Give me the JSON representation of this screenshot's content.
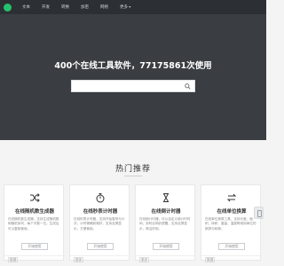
{
  "nav": {
    "items": [
      {
        "label": "文本"
      },
      {
        "label": "开发"
      },
      {
        "label": "转换"
      },
      {
        "label": "加密"
      },
      {
        "label": "网络"
      },
      {
        "label": "更多"
      }
    ]
  },
  "hero": {
    "title": "400个在线工具软件，77175861次使用",
    "search": {
      "placeholder": "",
      "value": ""
    }
  },
  "section": {
    "title": "热门推荐"
  },
  "cards": [
    {
      "icon": "shuffle-icon",
      "title": "在线随机数生成器",
      "desc": "在线随机数生成器，支持生成随机数和随机序列，每个字数一位，生成后可以复制使用。",
      "button": "开始使用",
      "tag": "数据"
    },
    {
      "icon": "stopwatch-icon",
      "title": "在线秒表计时器",
      "desc": "在线秒表计时器，支持开始暂停与计次，计时精确到毫秒，支持全屏显示，方便使用。",
      "button": "开始使用",
      "tag": "更多"
    },
    {
      "icon": "hourglass-icon",
      "title": "在线倒计时器",
      "desc": "在线倒计时器，可以自定义倒计时时间，到时后响铃提醒，支持全屏显示，简洁好用。",
      "button": "开始使用",
      "tag": "更多"
    },
    {
      "icon": "swap-icon",
      "title": "在线单位换算",
      "desc": "在线单位换算工具，支持长度、面积、体积、重量、温度等常用单位的换算与转换。",
      "button": "开始使用",
      "tag": "数据"
    }
  ],
  "colors": {
    "topbar": "#2c2f33",
    "hero": "#3a3e42",
    "brand": "#25c26e",
    "background": "#f4f4f4"
  }
}
